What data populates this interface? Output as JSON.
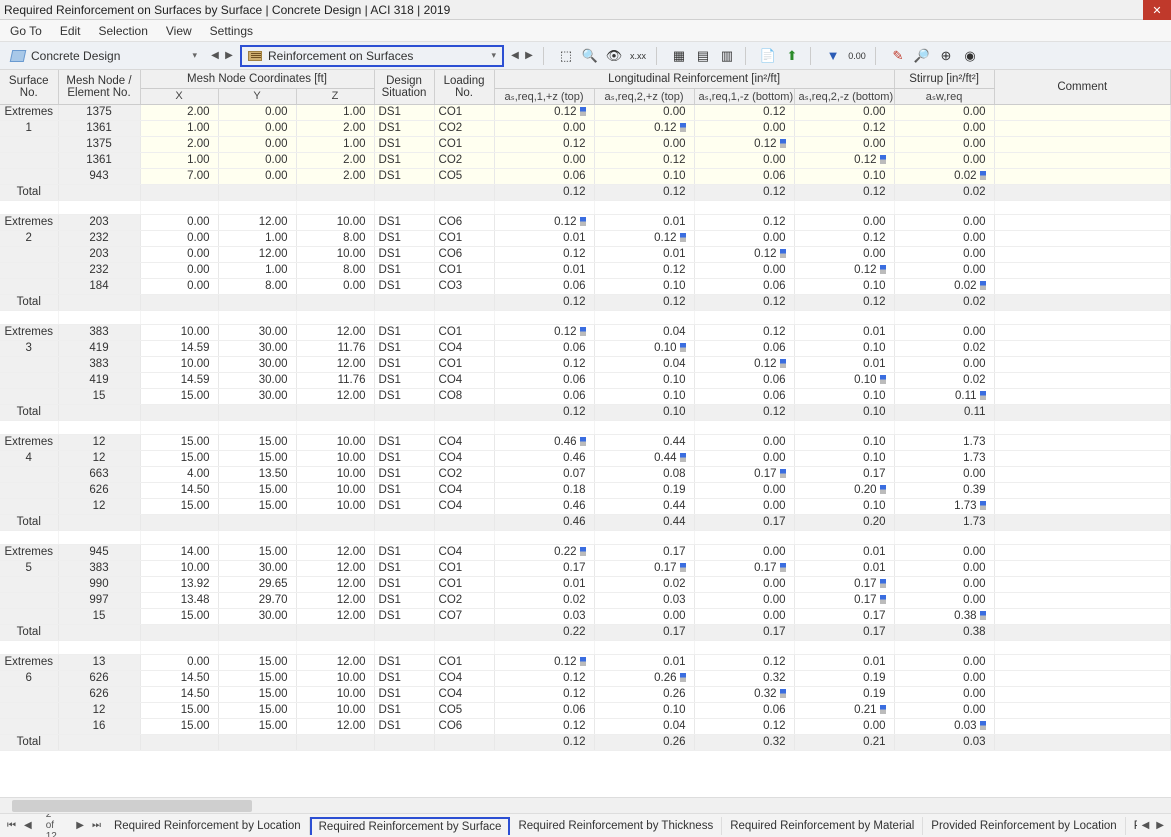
{
  "title": "Required Reinforcement on Surfaces by Surface | Concrete Design | ACI 318 | 2019",
  "menu": [
    "Go To",
    "Edit",
    "Selection",
    "View",
    "Settings"
  ],
  "dropdown1": "Concrete Design",
  "dropdown2": "Reinforcement on Surfaces",
  "headers": {
    "surf": "Surface\nNo.",
    "node": "Mesh Node /\nElement No.",
    "coord": "Mesh Node Coordinates [ft]",
    "x": "X",
    "y": "Y",
    "z": "Z",
    "ds": "Design\nSituation",
    "lo": "Loading\nNo.",
    "long": "Longitudinal Reinforcement [in²/ft]",
    "a1": "aₛ,req,1,+z (top)",
    "a2": "aₛ,req,2,+z (top)",
    "a3": "aₛ,req,1,-z (bottom)",
    "a4": "aₛ,req,2,-z (bottom)",
    "stir": "Stirrup [in²/ft²]",
    "asw": "aₛw,req",
    "cmt": "Comment"
  },
  "extremes_label": "Extremes",
  "total_label": "Total",
  "groups": [
    {
      "surf": "1",
      "yellow": true,
      "rows": [
        {
          "n": "1375",
          "x": "2.00",
          "y": "0.00",
          "z": "1.00",
          "ds": "DS1",
          "lo": "CO1",
          "a1": "0.12",
          "m1": 1,
          "a2": "0.00",
          "a3": "0.12",
          "a4": "0.00",
          "st": "0.00"
        },
        {
          "n": "1361",
          "x": "1.00",
          "y": "0.00",
          "z": "2.00",
          "ds": "DS1",
          "lo": "CO2",
          "a1": "0.00",
          "a2": "0.12",
          "m2": 1,
          "a3": "0.00",
          "a4": "0.12",
          "st": "0.00"
        },
        {
          "n": "1375",
          "x": "2.00",
          "y": "0.00",
          "z": "1.00",
          "ds": "DS1",
          "lo": "CO1",
          "a1": "0.12",
          "a2": "0.00",
          "a3": "0.12",
          "m3": 1,
          "a4": "0.00",
          "st": "0.00"
        },
        {
          "n": "1361",
          "x": "1.00",
          "y": "0.00",
          "z": "2.00",
          "ds": "DS1",
          "lo": "CO2",
          "a1": "0.00",
          "a2": "0.12",
          "a3": "0.00",
          "a4": "0.12",
          "m4": 1,
          "st": "0.00"
        },
        {
          "n": "943",
          "x": "7.00",
          "y": "0.00",
          "z": "2.00",
          "ds": "DS1",
          "lo": "CO5",
          "a1": "0.06",
          "a2": "0.10",
          "a3": "0.06",
          "a4": "0.10",
          "st": "0.02",
          "ms": 1
        }
      ],
      "total": {
        "a1": "0.12",
        "a2": "0.12",
        "a3": "0.12",
        "a4": "0.12",
        "st": "0.02"
      }
    },
    {
      "surf": "2",
      "rows": [
        {
          "n": "203",
          "x": "0.00",
          "y": "12.00",
          "z": "10.00",
          "ds": "DS1",
          "lo": "CO6",
          "a1": "0.12",
          "m1": 1,
          "a2": "0.01",
          "a3": "0.12",
          "a4": "0.00",
          "st": "0.00"
        },
        {
          "n": "232",
          "x": "0.00",
          "y": "1.00",
          "z": "8.00",
          "ds": "DS1",
          "lo": "CO1",
          "a1": "0.01",
          "a2": "0.12",
          "m2": 1,
          "a3": "0.00",
          "a4": "0.12",
          "st": "0.00"
        },
        {
          "n": "203",
          "x": "0.00",
          "y": "12.00",
          "z": "10.00",
          "ds": "DS1",
          "lo": "CO6",
          "a1": "0.12",
          "a2": "0.01",
          "a3": "0.12",
          "m3": 1,
          "a4": "0.00",
          "st": "0.00"
        },
        {
          "n": "232",
          "x": "0.00",
          "y": "1.00",
          "z": "8.00",
          "ds": "DS1",
          "lo": "CO1",
          "a1": "0.01",
          "a2": "0.12",
          "a3": "0.00",
          "a4": "0.12",
          "m4": 1,
          "st": "0.00"
        },
        {
          "n": "184",
          "x": "0.00",
          "y": "8.00",
          "z": "0.00",
          "ds": "DS1",
          "lo": "CO3",
          "a1": "0.06",
          "a2": "0.10",
          "a3": "0.06",
          "a4": "0.10",
          "st": "0.02",
          "ms": 1
        }
      ],
      "total": {
        "a1": "0.12",
        "a2": "0.12",
        "a3": "0.12",
        "a4": "0.12",
        "st": "0.02"
      }
    },
    {
      "surf": "3",
      "rows": [
        {
          "n": "383",
          "x": "10.00",
          "y": "30.00",
          "z": "12.00",
          "ds": "DS1",
          "lo": "CO1",
          "a1": "0.12",
          "m1": 1,
          "a2": "0.04",
          "a3": "0.12",
          "a4": "0.01",
          "st": "0.00"
        },
        {
          "n": "419",
          "x": "14.59",
          "y": "30.00",
          "z": "11.76",
          "ds": "DS1",
          "lo": "CO4",
          "a1": "0.06",
          "a2": "0.10",
          "m2": 1,
          "a3": "0.06",
          "a4": "0.10",
          "st": "0.02"
        },
        {
          "n": "383",
          "x": "10.00",
          "y": "30.00",
          "z": "12.00",
          "ds": "DS1",
          "lo": "CO1",
          "a1": "0.12",
          "a2": "0.04",
          "a3": "0.12",
          "m3": 1,
          "a4": "0.01",
          "st": "0.00"
        },
        {
          "n": "419",
          "x": "14.59",
          "y": "30.00",
          "z": "11.76",
          "ds": "DS1",
          "lo": "CO4",
          "a1": "0.06",
          "a2": "0.10",
          "a3": "0.06",
          "a4": "0.10",
          "m4": 1,
          "st": "0.02"
        },
        {
          "n": "15",
          "x": "15.00",
          "y": "30.00",
          "z": "12.00",
          "ds": "DS1",
          "lo": "CO8",
          "a1": "0.06",
          "a2": "0.10",
          "a3": "0.06",
          "a4": "0.10",
          "st": "0.11",
          "ms": 1
        }
      ],
      "total": {
        "a1": "0.12",
        "a2": "0.10",
        "a3": "0.12",
        "a4": "0.10",
        "st": "0.11"
      }
    },
    {
      "surf": "4",
      "rows": [
        {
          "n": "12",
          "x": "15.00",
          "y": "15.00",
          "z": "10.00",
          "ds": "DS1",
          "lo": "CO4",
          "a1": "0.46",
          "m1": 1,
          "a2": "0.44",
          "a3": "0.00",
          "a4": "0.10",
          "st": "1.73"
        },
        {
          "n": "12",
          "x": "15.00",
          "y": "15.00",
          "z": "10.00",
          "ds": "DS1",
          "lo": "CO4",
          "a1": "0.46",
          "a2": "0.44",
          "m2": 1,
          "a3": "0.00",
          "a4": "0.10",
          "st": "1.73"
        },
        {
          "n": "663",
          "x": "4.00",
          "y": "13.50",
          "z": "10.00",
          "ds": "DS1",
          "lo": "CO2",
          "a1": "0.07",
          "a2": "0.08",
          "a3": "0.17",
          "m3": 1,
          "a4": "0.17",
          "st": "0.00"
        },
        {
          "n": "626",
          "x": "14.50",
          "y": "15.00",
          "z": "10.00",
          "ds": "DS1",
          "lo": "CO4",
          "a1": "0.18",
          "a2": "0.19",
          "a3": "0.00",
          "a4": "0.20",
          "m4": 1,
          "st": "0.39"
        },
        {
          "n": "12",
          "x": "15.00",
          "y": "15.00",
          "z": "10.00",
          "ds": "DS1",
          "lo": "CO4",
          "a1": "0.46",
          "a2": "0.44",
          "a3": "0.00",
          "a4": "0.10",
          "st": "1.73",
          "ms": 1
        }
      ],
      "total": {
        "a1": "0.46",
        "a2": "0.44",
        "a3": "0.17",
        "a4": "0.20",
        "st": "1.73"
      }
    },
    {
      "surf": "5",
      "rows": [
        {
          "n": "945",
          "x": "14.00",
          "y": "15.00",
          "z": "12.00",
          "ds": "DS1",
          "lo": "CO4",
          "a1": "0.22",
          "m1": 1,
          "a2": "0.17",
          "a3": "0.00",
          "a4": "0.01",
          "st": "0.00"
        },
        {
          "n": "383",
          "x": "10.00",
          "y": "30.00",
          "z": "12.00",
          "ds": "DS1",
          "lo": "CO1",
          "a1": "0.17",
          "a2": "0.17",
          "m2": 1,
          "a3": "0.17",
          "m3": 1,
          "a4": "0.01",
          "st": "0.00"
        },
        {
          "n": "990",
          "x": "13.92",
          "y": "29.65",
          "z": "12.00",
          "ds": "DS1",
          "lo": "CO1",
          "a1": "0.01",
          "a2": "0.02",
          "a3": "0.00",
          "a4": "0.17",
          "m4": 1,
          "st": "0.00"
        },
        {
          "n": "997",
          "x": "13.48",
          "y": "29.70",
          "z": "12.00",
          "ds": "DS1",
          "lo": "CO2",
          "a1": "0.02",
          "a2": "0.03",
          "a3": "0.00",
          "a4": "0.17",
          "m4": 1,
          "st": "0.00"
        },
        {
          "n": "15",
          "x": "15.00",
          "y": "30.00",
          "z": "12.00",
          "ds": "DS1",
          "lo": "CO7",
          "a1": "0.03",
          "a2": "0.00",
          "a3": "0.00",
          "a4": "0.17",
          "st": "0.38",
          "ms": 1
        }
      ],
      "total": {
        "a1": "0.22",
        "a2": "0.17",
        "a3": "0.17",
        "a4": "0.17",
        "st": "0.38"
      }
    },
    {
      "surf": "6",
      "rows": [
        {
          "n": "13",
          "x": "0.00",
          "y": "15.00",
          "z": "12.00",
          "ds": "DS1",
          "lo": "CO1",
          "a1": "0.12",
          "m1": 1,
          "a2": "0.01",
          "a3": "0.12",
          "a4": "0.01",
          "st": "0.00"
        },
        {
          "n": "626",
          "x": "14.50",
          "y": "15.00",
          "z": "10.00",
          "ds": "DS1",
          "lo": "CO4",
          "a1": "0.12",
          "a2": "0.26",
          "m2": 1,
          "a3": "0.32",
          "a4": "0.19",
          "st": "0.00"
        },
        {
          "n": "626",
          "x": "14.50",
          "y": "15.00",
          "z": "10.00",
          "ds": "DS1",
          "lo": "CO4",
          "a1": "0.12",
          "a2": "0.26",
          "a3": "0.32",
          "m3": 1,
          "a4": "0.19",
          "st": "0.00"
        },
        {
          "n": "12",
          "x": "15.00",
          "y": "15.00",
          "z": "10.00",
          "ds": "DS1",
          "lo": "CO5",
          "a1": "0.06",
          "a2": "0.10",
          "a3": "0.06",
          "a4": "0.21",
          "m4": 1,
          "st": "0.00"
        },
        {
          "n": "16",
          "x": "15.00",
          "y": "15.00",
          "z": "12.00",
          "ds": "DS1",
          "lo": "CO6",
          "a1": "0.12",
          "a2": "0.04",
          "a3": "0.12",
          "a4": "0.00",
          "st": "0.03",
          "ms": 1
        }
      ],
      "total": {
        "a1": "0.12",
        "a2": "0.26",
        "a3": "0.32",
        "a4": "0.21",
        "st": "0.03"
      }
    }
  ],
  "footer": {
    "page": "2 of 12",
    "tabs": [
      "Required Reinforcement by Location",
      "Required Reinforcement by Surface",
      "Required Reinforcement by Thickness",
      "Required Reinforcement by Material",
      "Provided Reinforcement by Location",
      "Provided Reinforcement by"
    ],
    "active_tab": 1
  }
}
